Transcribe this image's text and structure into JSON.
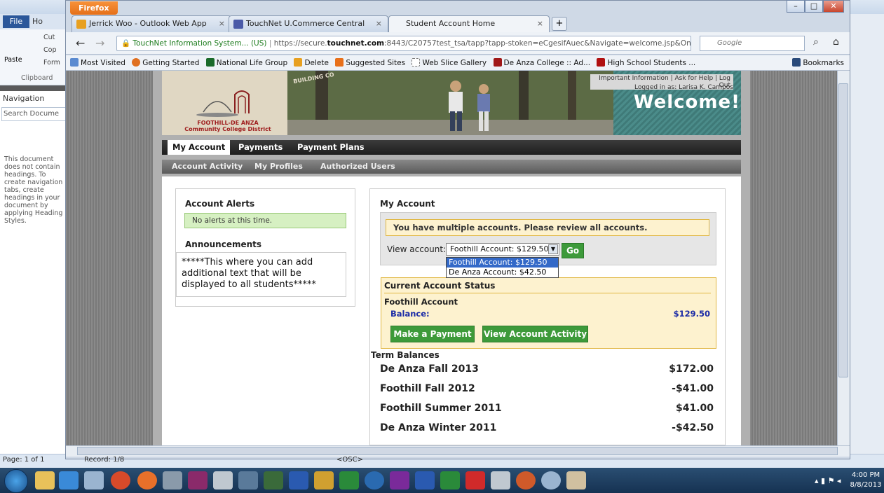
{
  "word": {
    "file_tab": "File",
    "home_tab_partial": "Ho",
    "clipboard_label": "Clipboard",
    "paste_label": "Paste",
    "cut_label": "Cut",
    "copy_label": "Cop",
    "format_label": "Form",
    "navigation_title": "Navigation",
    "search_placeholder": "Search Docume",
    "nav_message": "This document does not contain headings. To create navigation tabs, create headings in your document by applying Heading Styles.",
    "page_info": "Page: 1 of 1",
    "record": "Record: 1/8",
    "osc": "<OSC>"
  },
  "firefox": {
    "menu_button": "Firefox",
    "tabs": [
      {
        "label": "Jerrick Woo - Outlook Web App",
        "active": false
      },
      {
        "label": "TouchNet U.Commerce Central",
        "active": false
      },
      {
        "label": "Student Account Home",
        "active": true
      }
    ],
    "new_tab": "+",
    "url_site": "TouchNet Information System... (US)",
    "url_prefix": "https://secure.",
    "url_domain": "touchnet.com",
    "url_rest": ":8443/C20757test_tsa/tapp?tapp-stoken=eCgesifAuec&Navigate=welcome.jsp&OnEi",
    "search_placeholder": "Google",
    "bookmarks": [
      "Most Visited",
      "Getting Started",
      "National Life Group",
      "Delete",
      "Suggested Sites",
      "Web Slice Gallery",
      "De Anza College :: Ad...",
      "High School Students ..."
    ],
    "bookmarks_right": "Bookmarks"
  },
  "site": {
    "top_links": "Important Information | Ask for Help | Log Out",
    "logged_in": "Logged in as: Larisa K. Campos",
    "welcome": "Welcome!",
    "logo_line1": "FOOTHILL-DE ANZA",
    "logo_line2": "Community College District",
    "banner_text": "BUILDING CO",
    "main_nav": [
      "My Account",
      "Payments",
      "Payment Plans"
    ],
    "sub_nav": [
      "Account Activity",
      "My Profiles",
      "Authorized Users"
    ],
    "alerts_heading": "Account Alerts",
    "alerts_text": "No alerts at this time.",
    "announcements_heading": "Announcements",
    "announcements_text": "*****This where you can add additional text that will be displayed to all students*****",
    "my_account_heading": "My Account",
    "multiple_accounts_msg": "You have multiple accounts. Please review all accounts.",
    "view_account_label": "View account:",
    "selected_account": "Foothill Account: $129.50",
    "account_options": [
      "Foothill Account: $129.50",
      "De Anza Account: $42.50"
    ],
    "go_button": "Go",
    "status_heading": "Current Account Status",
    "account_name": "Foothill Account",
    "balance_label": "Balance:",
    "balance_value": "$129.50",
    "make_payment": "Make a Payment",
    "view_activity": "View Account Activity",
    "term_heading": "Term Balances",
    "terms": [
      {
        "name": "De Anza Fall 2013",
        "amount": "$172.00"
      },
      {
        "name": "Foothill Fall 2012",
        "amount": "-$41.00"
      },
      {
        "name": "Foothill Summer 2011",
        "amount": "$41.00"
      },
      {
        "name": "De Anza Winter 2011",
        "amount": "-$42.50"
      }
    ]
  },
  "taskbar": {
    "time": "4:00 PM",
    "date": "8/8/2013"
  }
}
